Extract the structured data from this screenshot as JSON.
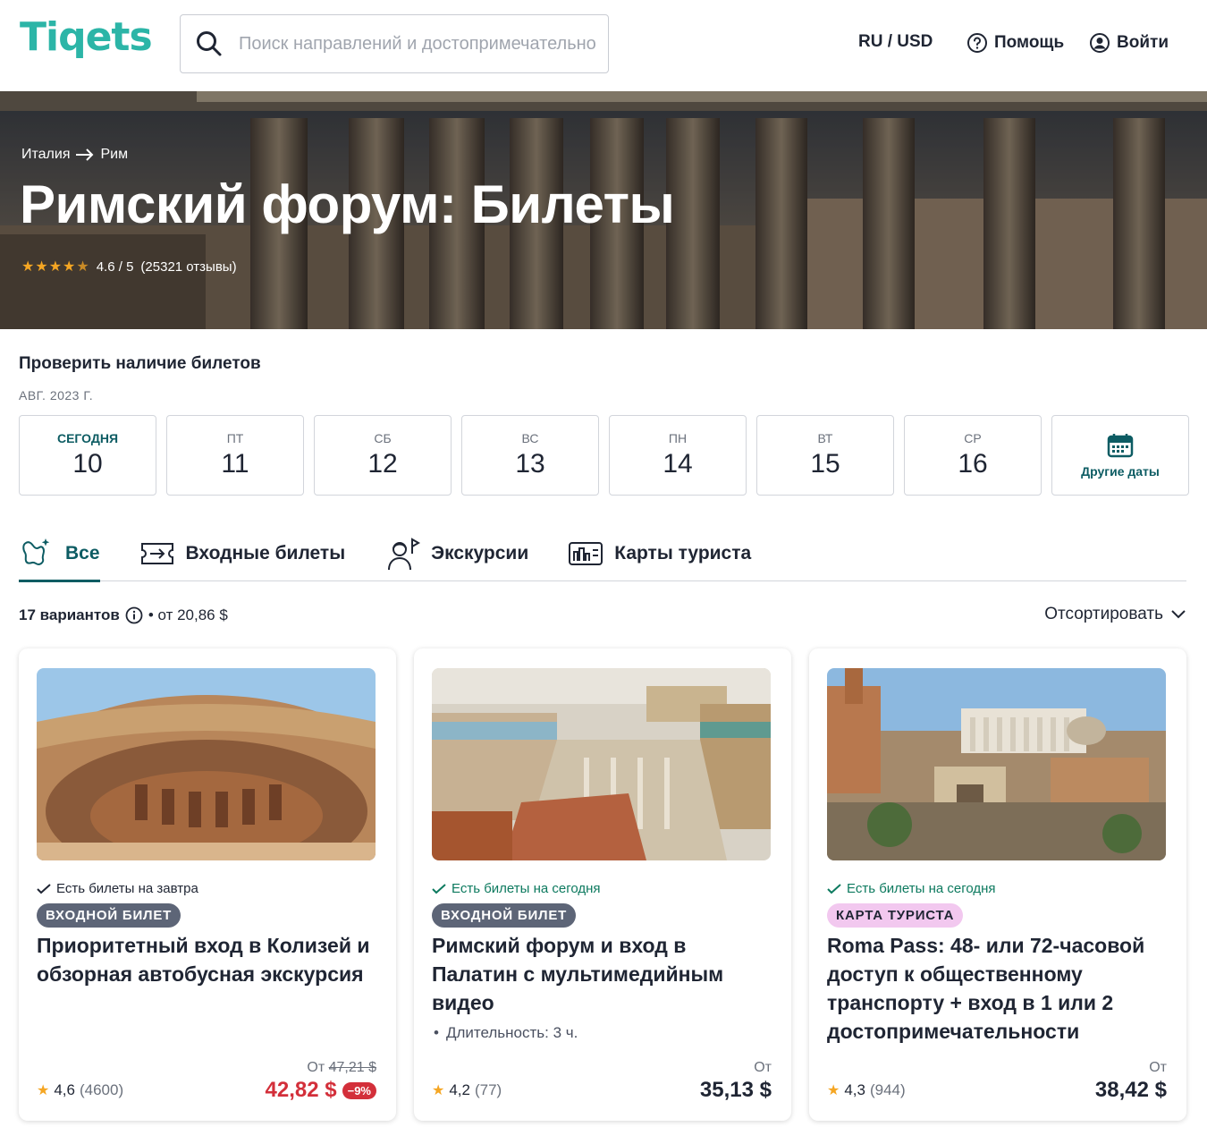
{
  "header": {
    "logo": "Tiqets",
    "search_placeholder": "Поиск направлений и достопримечательностей",
    "locale": "RU / USD",
    "help": "Помощь",
    "login": "Войти"
  },
  "hero": {
    "breadcrumb": [
      "Италия",
      "Рим"
    ],
    "title": "Римский форум: Билеты",
    "rating_text": "4.6 / 5",
    "reviews": "(25321 отзывы)"
  },
  "availability": {
    "title": "Проверить наличие билетов",
    "month": "АВГ. 2023 Г.",
    "dates": [
      {
        "dow": "СЕГОДНЯ",
        "num": "10"
      },
      {
        "dow": "ПТ",
        "num": "11"
      },
      {
        "dow": "СБ",
        "num": "12"
      },
      {
        "dow": "ВС",
        "num": "13"
      },
      {
        "dow": "ПН",
        "num": "14"
      },
      {
        "dow": "ВТ",
        "num": "15"
      },
      {
        "dow": "СР",
        "num": "16"
      }
    ],
    "other_dates": "Другие даты"
  },
  "tabs": [
    "Все",
    "Входные билеты",
    "Экскурсии",
    "Карты туриста"
  ],
  "results": {
    "count": "17 вариантов",
    "from": "• от 20,86 $",
    "sort": "Отсортировать"
  },
  "cards": [
    {
      "availability": "Есть билеты на завтра",
      "badge": "ВХОДНОЙ БИЛЕТ",
      "title": "Приоритетный вход в Колизей и обзорная автобусная экскурсия",
      "rating": "4,6",
      "reviews": "(4600)",
      "from_label": "От",
      "old_price": "47,21 $",
      "price": "42,82 $",
      "discount": "−9%"
    },
    {
      "availability": "Есть билеты на сегодня",
      "badge": "ВХОДНОЙ БИЛЕТ",
      "title": "Римский форум и вход в Палатин с мультимедийным видео",
      "duration": "Длительность: 3 ч.",
      "rating": "4,2",
      "reviews": "(77)",
      "from_label": "От",
      "price": "35,13 $"
    },
    {
      "availability": "Есть билеты на сегодня",
      "badge": "КАРТА ТУРИСТА",
      "title": "Roma Pass: 48- или 72-часовой доступ к общественному транспорту + вход в 1 или 2 достопримечательности",
      "rating": "4,3",
      "reviews": "(944)",
      "from_label": "От",
      "price": "38,42 $"
    }
  ],
  "colors": {
    "brand": "#2cb5a7",
    "accent": "#0d5c63",
    "sale": "#d32f3a",
    "star": "#f5a623"
  },
  "icons": {
    "search": "search-icon",
    "help": "question-circle-icon",
    "user": "user-circle-icon",
    "calendar": "calendar-icon"
  }
}
